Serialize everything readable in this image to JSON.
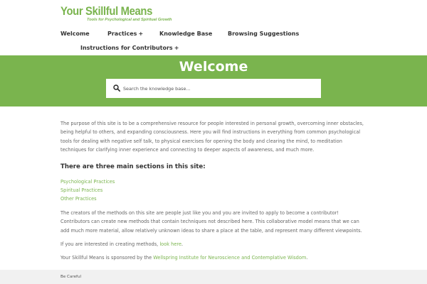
{
  "site": {
    "title": "Your Skillful Means",
    "tagline": "Tools for Psychological and Spiritual Growth"
  },
  "nav": {
    "items": [
      {
        "label": "Welcome",
        "has_submenu": false
      },
      {
        "label": "Practices",
        "has_submenu": true
      },
      {
        "label": "Knowledge Base",
        "has_submenu": false
      },
      {
        "label": "Browsing Suggestions",
        "has_submenu": false
      },
      {
        "label": "Instructions for Contributors",
        "has_submenu": true
      }
    ],
    "submenu_glyph": "+"
  },
  "hero": {
    "title": "Welcome",
    "search_placeholder": "Search the knowledge base...",
    "search_icon": "search-icon"
  },
  "content": {
    "intro": "The purpose of this site is to be a comprehensive resource for people interested in personal growth, overcoming inner obstacles, being helpful to others, and expanding consciousness. Here you will find instructions in everything from common psychological tools for dealing with negative self talk, to physical exercises for opening the body and clearing the mind, to meditation techniques for clarifying inner experience and connecting to deeper aspects of awareness, and much more.",
    "sections_heading": "There are three main sections in this site:",
    "sections": [
      "Psychological Practices",
      "Spiritual Practices",
      "Other Practices"
    ],
    "contributors": "The creators of the methods on this site are people just like you and you are invited to apply to become a contributor! Contributors can create new methods that contain techniques not described here. This collaborative model means that we can add much more material, allow relatively unknown ideas to share a place at the table, and represent many different viewpoints.",
    "creating_prefix": "If you are interested in creating methods, ",
    "creating_link": "look here",
    "creating_suffix": ".",
    "sponsor_prefix": "Your Skillful Means is sponsored by the ",
    "sponsor_link": "Wellspring Institute for Neuroscience and Contemplative Wisdom",
    "sponsor_suffix": "."
  },
  "footer": {
    "text": "Be Careful"
  },
  "colors": {
    "accent": "#7ab44e",
    "footer_bg": "#f1f1f1"
  }
}
